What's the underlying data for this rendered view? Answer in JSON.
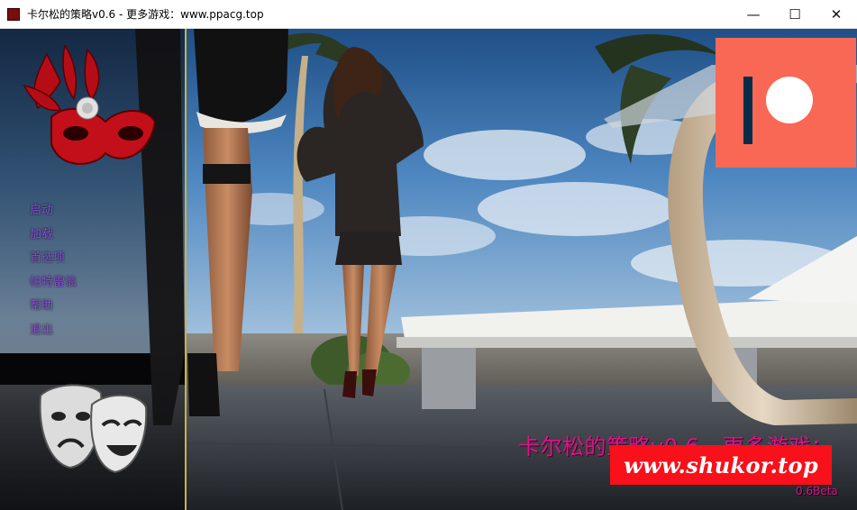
{
  "window": {
    "title": "卡尔松的策略v0.6 - 更多游戏：www.ppacg.top",
    "controls": {
      "minimize": "—",
      "maximize": "☐",
      "close": "✕"
    }
  },
  "menu": {
    "items": [
      {
        "label": "启动"
      },
      {
        "label": "加载"
      },
      {
        "label": "首选项"
      },
      {
        "label": "帕特雷翁"
      },
      {
        "label": "帮助"
      },
      {
        "label": "退出"
      }
    ]
  },
  "overlay": {
    "title_line1": "卡尔松的策略v0.6 - 更多游戏：",
    "title_line2": "p",
    "watermark": "www.shukor.top",
    "version": "0.6Beta"
  },
  "colors": {
    "menu_text": "#8a4fd8",
    "title_text": "#e0128a",
    "patreon_bg": "#f96854",
    "watermark_bg": "#f8101a",
    "divider": "#c9b24a"
  },
  "icons": [
    "app-icon",
    "carnival-mask-icon",
    "theater-masks-icon",
    "patreon-logo-icon"
  ]
}
